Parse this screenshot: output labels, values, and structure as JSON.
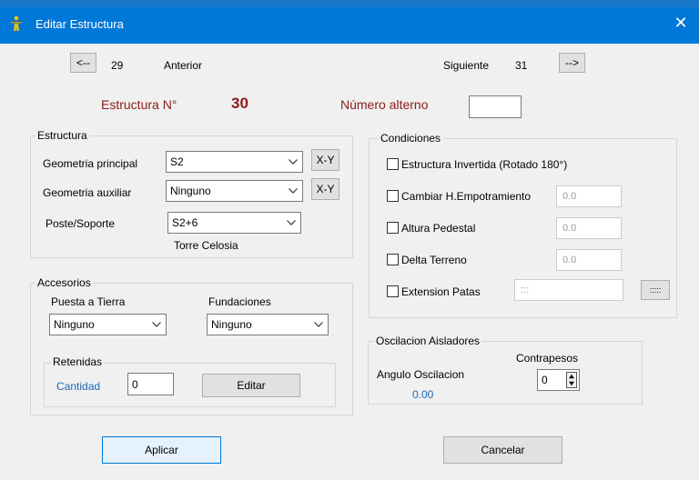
{
  "window": {
    "title": "Editar Estructura",
    "close_glyph": "✕"
  },
  "nav": {
    "prev_button": "<--",
    "prev_number": "29",
    "prev_label": "Anterior",
    "next_label": "Siguiente",
    "next_number": "31",
    "next_button": "-->"
  },
  "header": {
    "structure_label": "Estructura N°",
    "structure_number": "30",
    "alt_number_label": "Número alterno",
    "alt_number_value": ""
  },
  "estructura": {
    "group_label": "Estructura",
    "geom_principal_label": "Geometria principal",
    "geom_principal_value": "S2",
    "geom_auxiliar_label": "Geometria auxiliar",
    "geom_auxiliar_value": "Ninguno",
    "xy_label": "X-Y",
    "poste_label": "Poste/Soporte",
    "poste_value": "S2+6",
    "poste_type": "Torre Celosia"
  },
  "accesorios": {
    "group_label": "Accesorios",
    "puesta_label": "Puesta a Tierra",
    "puesta_value": "Ninguno",
    "fundaciones_label": "Fundaciones",
    "fundaciones_value": "Ninguno",
    "retenidas_label": "Retenidas",
    "cantidad_label": "Cantidad",
    "cantidad_value": "0",
    "editar_label": "Editar"
  },
  "condiciones": {
    "group_label": "Condiciones",
    "invertida_label": "Estructura Invertida (Rotado 180°)",
    "cambiar_label": "Cambiar H.Empotramiento",
    "cambiar_value": "0.0",
    "altura_label": "Altura Pedestal",
    "altura_value": "0.0",
    "delta_label": "Delta Terreno",
    "delta_value": "0.0",
    "extension_label": "Extension Patas",
    "extension_value": ":::",
    "extension_button": ":::::"
  },
  "oscilacion": {
    "group_label": "Oscilacion Aisladores",
    "angulo_label": "Angulo Oscilacion",
    "angulo_value": "0.00",
    "contrapesos_label": "Contrapesos",
    "contrapesos_value": "0"
  },
  "footer": {
    "apply_label": "Aplicar",
    "cancel_label": "Cancelar"
  },
  "colors": {
    "titlebar": "#0078d7",
    "accent_red": "#8b1a1a",
    "accent_blue": "#1c68b6"
  },
  "icons": {
    "app": "stick-figure-icon",
    "close": "close-icon"
  }
}
